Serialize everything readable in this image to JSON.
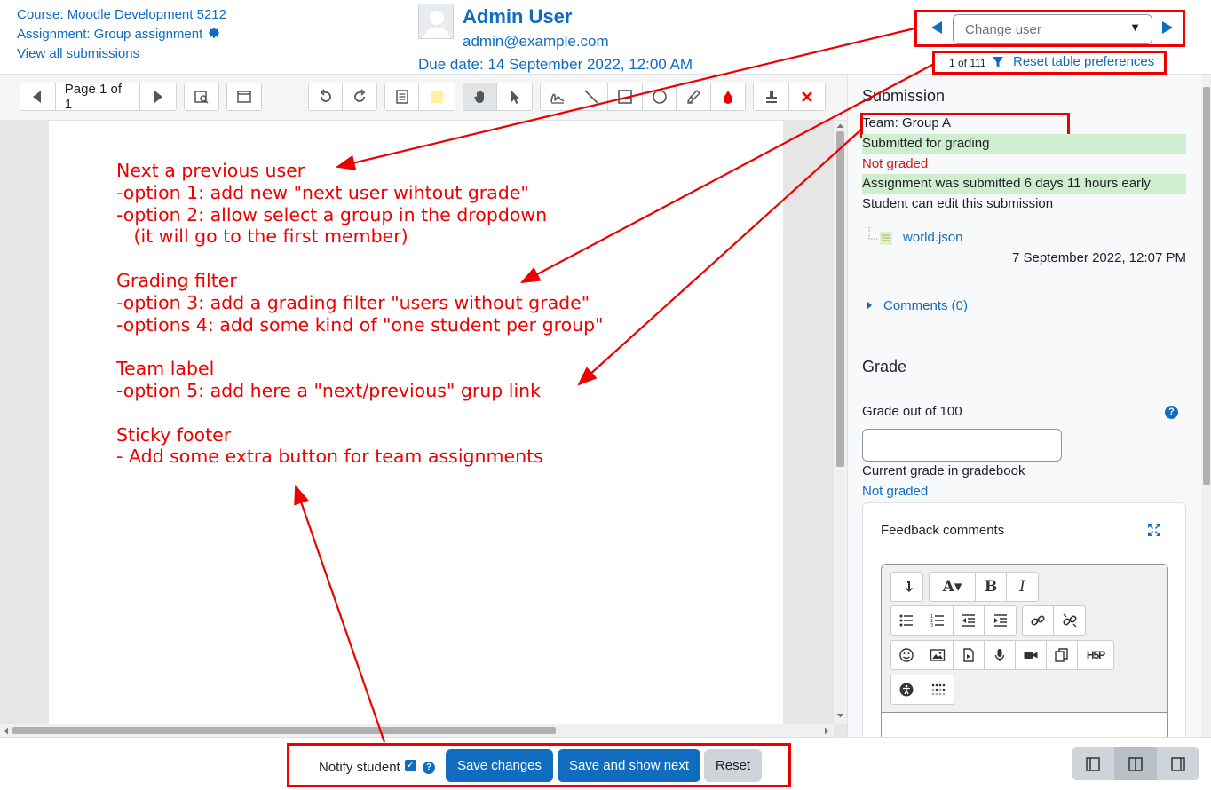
{
  "header": {
    "course_link": "Course: Moodle Development 5212",
    "assignment_link": "Assignment: Group assignment",
    "view_all_link": "View all submissions",
    "user_name": "Admin User",
    "user_email": "admin@example.com",
    "due_date": "Due date: 14 September 2022, 12:00 AM",
    "change_user_placeholder": "Change user",
    "counter": "1 of 111",
    "reset_prefs": "Reset table preferences"
  },
  "toolbar": {
    "page_label": "Page 1 of 1",
    "active_tool": "pan-icon"
  },
  "annotation": {
    "text": "Next a previous user\n-option 1: add new \"next user wihtout grade\"\n-option 2: allow select a group in the dropdown\n   (it will go to the first member)\n\nGrading filter\n-option 3: add a grading filter \"users without grade\"\n-options 4: add some kind of \"one student per group\"\n\nTeam label\n-option 5: add here a \"next/previous\" grup link\n\nSticky footer\n- Add some extra button for team assignments",
    "color": "#e00000"
  },
  "submission": {
    "heading": "Submission",
    "team": "Team: Group A",
    "status": "Submitted for grading",
    "grading_status": "Not graded",
    "timing": "Assignment was submitted 6 days 11 hours early",
    "edit_status": "Student can edit this submission",
    "file_name": "world.json",
    "file_date": "7 September 2022, 12:07 PM",
    "comments": "Comments (0)"
  },
  "grade": {
    "heading": "Grade",
    "grade_label": "Grade out of 100",
    "grade_value": "",
    "gradebook_label": "Current grade in gradebook",
    "gradebook_value": "Not graded",
    "feedback_title": "Feedback comments"
  },
  "footer": {
    "notify_label": "Notify student",
    "notify_checked": true,
    "save_label": "Save changes",
    "save_next_label": "Save and show next",
    "reset_label": "Reset",
    "active_layout": "collapse-none"
  },
  "colors": {
    "primary": "#0f6cbf",
    "success_bg": "#cfeed0",
    "danger_text": "#c61b1b",
    "highlight": "#e00000"
  }
}
